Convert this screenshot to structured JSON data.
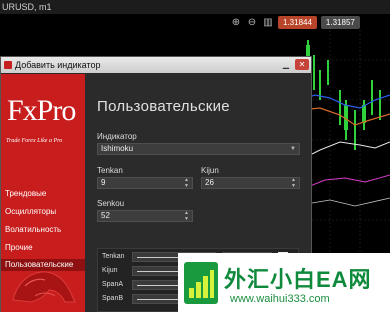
{
  "chart": {
    "title": "URUSD, m1",
    "sell_price": "1.31844",
    "buy_price": "1.31857"
  },
  "dialog": {
    "title": "Добавить индикатор",
    "brand": {
      "logo": "FxPro",
      "tagline": "Trade Forex Like a Pro"
    },
    "categories": [
      {
        "label": "Трендовые"
      },
      {
        "label": "Осцилляторы"
      },
      {
        "label": "Волатильность"
      },
      {
        "label": "Прочие"
      },
      {
        "label": "Пользовательские"
      }
    ],
    "heading": "Пользовательские",
    "indicator_label": "Индикатор",
    "indicator_value": "Ishimoku",
    "tenkan_label": "Tenkan",
    "tenkan_value": "9",
    "kijun_label": "Kijun",
    "kijun_value": "26",
    "senkou_label": "Senkou",
    "senkou_value": "52",
    "lines": [
      {
        "label": "Tenkan",
        "width": "1",
        "color": "#d8261c"
      },
      {
        "label": "Kijun"
      },
      {
        "label": "SpanA"
      },
      {
        "label": "SpanB"
      }
    ]
  },
  "watermark": {
    "title": "外汇小白EA网",
    "url": "www.waihui333.com"
  }
}
